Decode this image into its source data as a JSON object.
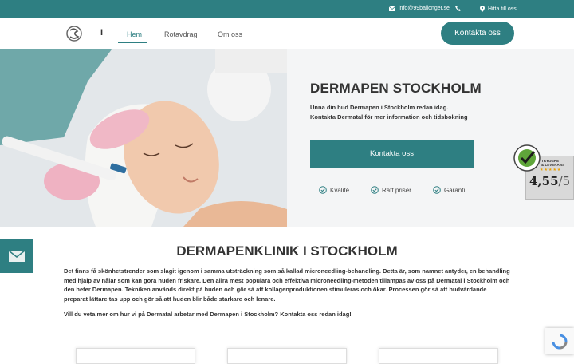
{
  "topbar": {
    "email": "info@99ballonger.se",
    "map_label": "Hitta till oss"
  },
  "nav": {
    "separator": "I",
    "items": [
      {
        "label": "Hem",
        "active": true
      },
      {
        "label": "Rotavdrag",
        "active": false
      },
      {
        "label": "Om oss",
        "active": false
      }
    ],
    "cta": "Kontakta oss"
  },
  "hero": {
    "title": "DERMAPEN STOCKHOLM",
    "text": "Unna din hud Dermapen i Stockholm redan idag. Kontakta Dermatal för mer information och tidsbokning",
    "cta": "Kontakta oss",
    "features": [
      "Kvalité",
      "Rätt priser",
      "Garanti"
    ]
  },
  "badge": {
    "percent_text": "100%",
    "top_line_1": "TRYGGHET",
    "top_line_2": "& LEVERANS",
    "score": "4,55",
    "max": "/5"
  },
  "content": {
    "title": "DERMAPENKLINIK I STOCKHOLM",
    "paragraph_1": "Det finns få skönhetstrender som slagit igenom i samma utsträckning som så kallad microneedling-behandling. Detta är, som namnet antyder, en behandling med hjälp av nålar som kan göra huden friskare. Den allra mest populära och effektiva microneedling-metoden tillämpas av oss på Dermatal i Stockholm och den heter Dermapen. Tekniken används direkt på huden och gör så att kollagenproduktionen stimuleras och ökar. Processen gör så att hudvårdande preparat lättare tas upp och gör så att huden blir både starkare och lenare.",
    "paragraph_2": "Vill du veta mer om hur vi på Dermatal arbetar med Dermapen i Stockholm? Kontakta oss redan idag!"
  },
  "colors": {
    "brand": "#2e7f82",
    "star": "#e8a000"
  }
}
